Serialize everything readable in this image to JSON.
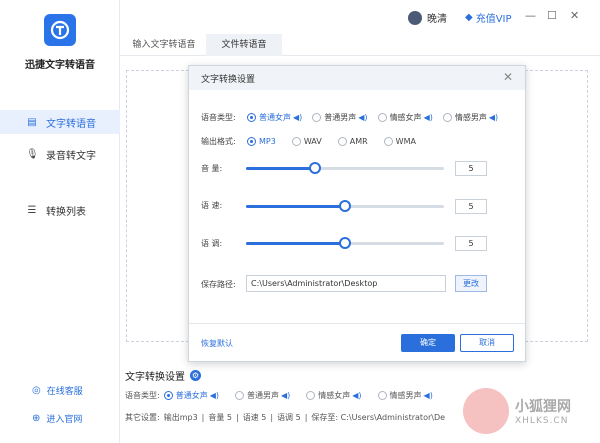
{
  "app": {
    "name": "迅捷文字转语音"
  },
  "sidebar": {
    "items": [
      {
        "icon": "text-icon",
        "label": "文字转语音"
      },
      {
        "icon": "mic-icon",
        "label": "录音转文字"
      },
      {
        "icon": "list-icon",
        "label": "转换列表"
      }
    ],
    "footer": [
      {
        "icon": "headset-icon",
        "label": "在线客服"
      },
      {
        "icon": "globe-icon",
        "label": "进入官网"
      }
    ]
  },
  "topbar": {
    "username": "晚清",
    "vip_label": "充值VIP",
    "minimize": "—",
    "maximize": "☐",
    "close": "✕"
  },
  "tabs": [
    {
      "label": "输入文字转语音"
    },
    {
      "label": "文件转语音"
    }
  ],
  "bottom": {
    "title": "文字转换设置",
    "voice_label": "语音类型:",
    "voices": [
      {
        "label": "普通女声",
        "selected": true
      },
      {
        "label": "普通男声",
        "selected": false
      },
      {
        "label": "情感女声",
        "selected": false
      },
      {
        "label": "情感男声",
        "selected": false
      }
    ],
    "other_label": "其它设置:",
    "other": [
      "输出mp3",
      "音量 5",
      "语速 5",
      "语调 5",
      "保存至: C:\\Users\\Administrator\\De"
    ]
  },
  "dialog": {
    "title": "文字转换设置",
    "voice_label": "语音类型:",
    "voices": [
      {
        "label": "普通女声",
        "selected": true
      },
      {
        "label": "普通男声",
        "selected": false
      },
      {
        "label": "情感女声",
        "selected": false
      },
      {
        "label": "情感男声",
        "selected": false
      }
    ],
    "format_label": "输出格式:",
    "formats": [
      {
        "label": "MP3",
        "selected": true
      },
      {
        "label": "WAV",
        "selected": false
      },
      {
        "label": "AMR",
        "selected": false
      },
      {
        "label": "WMA",
        "selected": false
      }
    ],
    "sliders": [
      {
        "label": "音    量:",
        "value": "5",
        "level": 0.35
      },
      {
        "label": "语    速:",
        "value": "5",
        "level": 0.5
      },
      {
        "label": "语    调:",
        "value": "5",
        "level": 0.5
      }
    ],
    "path_label": "保存路径:",
    "path_value": "C:\\Users\\Administrator\\Desktop",
    "change_label": "更改",
    "restore_label": "恢复默认",
    "ok_label": "确定",
    "cancel_label": "取消"
  },
  "watermark": {
    "cn": "小狐狸网",
    "en": "XHLKS.CN"
  },
  "colors": {
    "accent": "#2a6fdb",
    "active_bg": "#e8f0fd"
  }
}
